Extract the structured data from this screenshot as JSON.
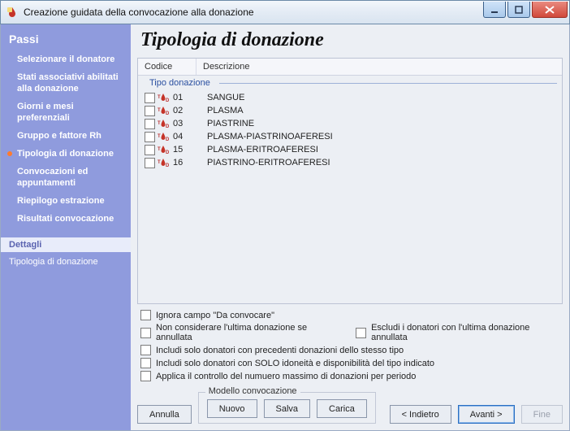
{
  "window": {
    "title": "Creazione guidata della convocazione alla donazione"
  },
  "sidebar": {
    "steps_header": "Passi",
    "steps": [
      {
        "label": "Selezionare il donatore"
      },
      {
        "label": "Stati associativi abilitati alla donazione"
      },
      {
        "label": "Giorni e mesi preferenziali"
      },
      {
        "label": "Gruppo e fattore Rh"
      },
      {
        "label": "Tipologia di donazione",
        "active": true
      },
      {
        "label": "Convocazioni ed appuntamenti"
      },
      {
        "label": "Riepilogo estrazione"
      },
      {
        "label": "Risultati convocazione"
      }
    ],
    "details_header": "Dettagli",
    "details_body": "Tipologia di donazione"
  },
  "main": {
    "title": "Tipologia di donazione",
    "columns": {
      "code": "Codice",
      "desc": "Descrizione"
    },
    "group_label": "Tipo donazione",
    "rows": [
      {
        "code": "01",
        "desc": "SANGUE"
      },
      {
        "code": "02",
        "desc": "PLASMA"
      },
      {
        "code": "03",
        "desc": "PIASTRINE"
      },
      {
        "code": "04",
        "desc": "PLASMA-PIASTRINOAFERESI"
      },
      {
        "code": "15",
        "desc": "PLASMA-ERITROAFERESI"
      },
      {
        "code": "16",
        "desc": "PIASTRINO-ERITROAFERESI"
      }
    ],
    "options": {
      "opt1": "Ignora campo \"Da convocare\"",
      "opt2a": "Non considerare l'ultima donazione se annullata",
      "opt2b": "Escludi i donatori con l'ultima donazione annullata",
      "opt3": "Includi solo donatori con precedenti donazioni dello stesso tipo",
      "opt4": "Includi solo donatori con SOLO idoneità e disponibilità del tipo indicato",
      "opt5": "Applica il controllo del numuero massimo di donazioni per periodo"
    },
    "buttons": {
      "cancel": "Annulla",
      "model_group": "Modello convocazione",
      "new": "Nuovo",
      "save": "Salva",
      "load": "Carica",
      "back": "< Indietro",
      "next": "Avanti >",
      "finish": "Fine"
    }
  }
}
